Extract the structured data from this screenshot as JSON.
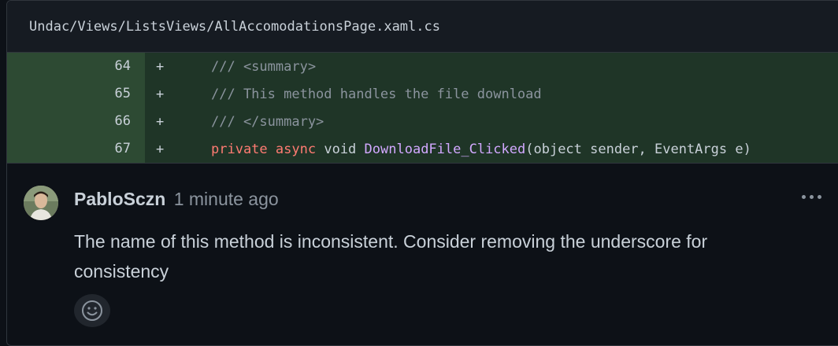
{
  "file": {
    "path": "Undac/Views/ListsViews/AllAccomodationsPage.xaml.cs"
  },
  "diff": {
    "lines": [
      {
        "number": "64",
        "sign": "+",
        "code": "/// <summary>"
      },
      {
        "number": "65",
        "sign": "+",
        "code": "/// This method handles the file download"
      },
      {
        "number": "66",
        "sign": "+",
        "code": "/// </summary>"
      },
      {
        "number": "67",
        "sign": "+",
        "tokens": {
          "kw1": "private",
          "kw2": "async",
          "type": "void",
          "fn": "DownloadFile_Clicked",
          "rest": "(object sender, EventArgs e)"
        }
      }
    ]
  },
  "comment": {
    "author": "PabloSczn",
    "time": "1 minute ago",
    "body": "The name of this method is inconsistent. Consider removing the underscore for consistency"
  },
  "icons": {
    "more": "kebab-horizontal-icon",
    "reaction": "smiley-icon",
    "avatar": "user-avatar"
  },
  "colors": {
    "background": "#0d1117",
    "added_line": "#1f3527",
    "added_gutter": "#2d4a33",
    "keyword": "#ff7b72",
    "function": "#d2a8ff",
    "comment": "#8b949e"
  }
}
